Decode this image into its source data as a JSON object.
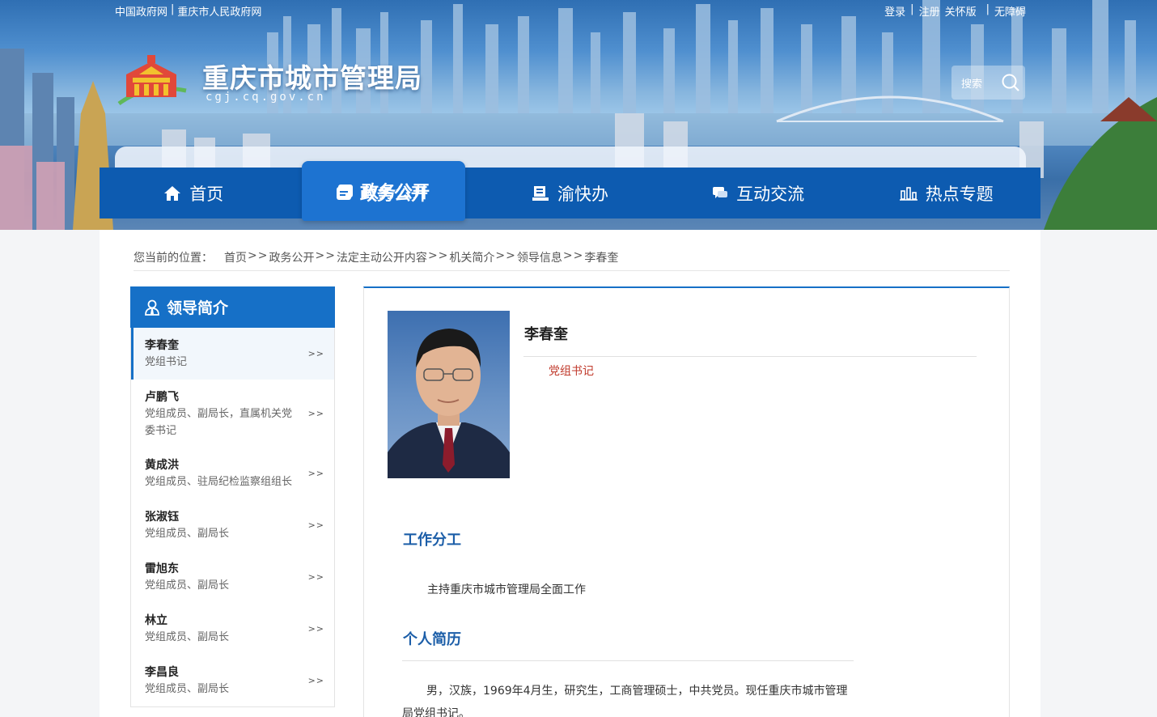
{
  "top_links": {
    "left": [
      "中国政府网",
      "重庆市人民政府网"
    ],
    "separator": "|",
    "right": [
      "登录",
      "注册",
      "关怀版",
      "无障碍"
    ]
  },
  "site": {
    "title": "重庆市城市管理局",
    "domain": "cgj.cq.gov.cn",
    "logo_icon": "government-building-logo"
  },
  "search": {
    "label": "搜索",
    "icon": "search-icon"
  },
  "nav": {
    "items": [
      {
        "label": "首页",
        "icon": "home-icon"
      },
      {
        "label": "政务公开",
        "icon": "document-icon"
      },
      {
        "label": "渝快办",
        "icon": "service-desk-icon"
      },
      {
        "label": "互动交流",
        "icon": "chat-icon"
      },
      {
        "label": "热点专题",
        "icon": "bar-chart-icon"
      }
    ],
    "active_index": 1
  },
  "breadcrumb": {
    "prefix": "您当前的位置：",
    "separator": ">>",
    "items": [
      "首页",
      "政务公开",
      "法定主动公开内容",
      "机关简介",
      "领导信息",
      "李春奎"
    ]
  },
  "sidebar": {
    "title": "领导简介",
    "icon": "leader-icon",
    "arrow": ">>",
    "leaders": [
      {
        "name": "李春奎",
        "position": "党组书记"
      },
      {
        "name": "卢鹏飞",
        "position": "党组成员、副局长，直属机关党委书记"
      },
      {
        "name": "黄成洪",
        "position": "党组成员、驻局纪检监察组组长"
      },
      {
        "name": "张淑钰",
        "position": "党组成员、副局长"
      },
      {
        "name": "雷旭东",
        "position": "党组成员、副局长"
      },
      {
        "name": "林立",
        "position": "党组成员、副局长"
      },
      {
        "name": "李昌良",
        "position": "党组成员、副局长"
      }
    ]
  },
  "profile": {
    "name": "李春奎",
    "title": "党组书记",
    "duty_heading": "工作分工",
    "duty_text": "主持重庆市城市管理局全面工作",
    "resume_heading": "个人简历",
    "resume_text": "男，汉族，1969年4月生，研究生，工商管理硕士，中共党员。现任重庆市城市管理局党组书记。"
  },
  "colors": {
    "nav_bg": "#0d5bb0",
    "nav_active": "#1d73d1",
    "sidebar_head": "#1670c7",
    "section_title": "#1c5ea8",
    "title_red": "#c0392b"
  }
}
